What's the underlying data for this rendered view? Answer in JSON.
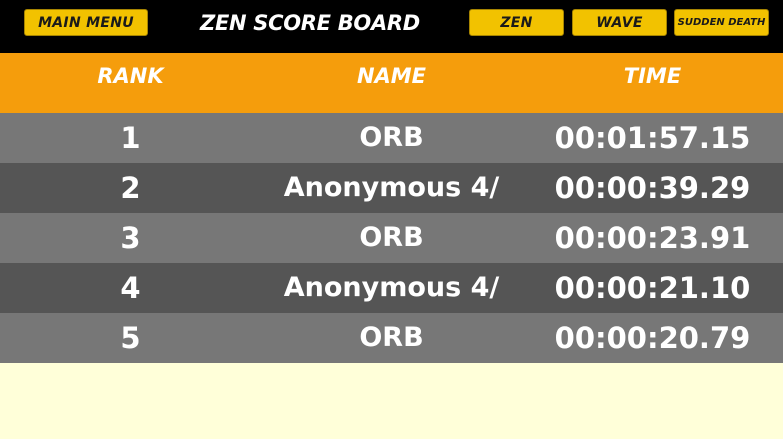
{
  "topbar": {
    "main_menu_label": "MAIN MENU",
    "title": "ZEN SCORE BOARD",
    "modes": [
      "ZEN",
      "WAVE",
      "SUDDEN DEATH"
    ]
  },
  "table": {
    "headers": {
      "rank": "RANK",
      "name": "NAME",
      "time": "TIME"
    },
    "rows": [
      {
        "rank": "1",
        "name": "ORB",
        "time": "00:01:57.15"
      },
      {
        "rank": "2",
        "name": "Anonymous 4/",
        "time": "00:00:39.29"
      },
      {
        "rank": "3",
        "name": "ORB",
        "time": "00:00:23.91"
      },
      {
        "rank": "4",
        "name": "Anonymous 4/",
        "time": "00:00:21.10"
      },
      {
        "rank": "5",
        "name": "ORB",
        "time": "00:00:20.79"
      }
    ]
  },
  "colors": {
    "topbar_bg": "#000000",
    "button_bg": "#f2c200",
    "header_bg": "#f59d0c",
    "row_light": "#777777",
    "row_dark": "#555555",
    "page_bg": "#ffffd9"
  }
}
